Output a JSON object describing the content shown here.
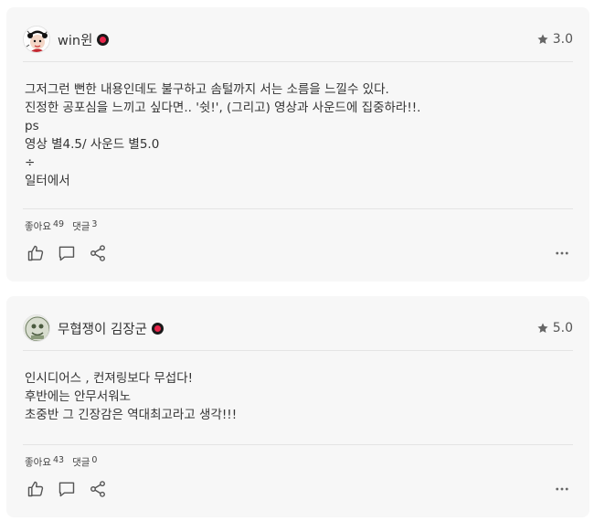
{
  "reviews": [
    {
      "username": "win윈",
      "rating": "3.0",
      "lines": [
        "그저그런 뻔한 내용인데도 불구하고 솜털까지 서는 소름을 느낄수 있다.",
        "진정한 공포심을 느끼고 싶다면.. '쉿!', (그리고) 영상과 사운드에 집중하라!!.",
        "ps",
        "영상 별4.5/ 사운드 별5.0",
        "÷",
        "일터에서"
      ],
      "likes_label": "좋아요",
      "likes_count": "49",
      "comments_label": "댓글",
      "comments_count": "3"
    },
    {
      "username": "무협쟁이 김장군",
      "rating": "5.0",
      "lines": [
        "인시디어스 , 컨져링보다 무섭다!",
        "후반에는 안무서워노",
        "초중반 그 긴장감은 역대최고라고 생각!!!"
      ],
      "likes_label": "좋아요",
      "likes_count": "43",
      "comments_label": "댓글",
      "comments_count": "0"
    }
  ],
  "icons": {
    "like": "thumbs-up-icon",
    "comment": "comment-bubble-icon",
    "share": "share-icon",
    "more": "more-dots-icon",
    "star": "star-icon"
  },
  "colors": {
    "card_bg": "#f7f7f7",
    "badge_red": "#e8254b",
    "icon_gray": "#555555"
  }
}
